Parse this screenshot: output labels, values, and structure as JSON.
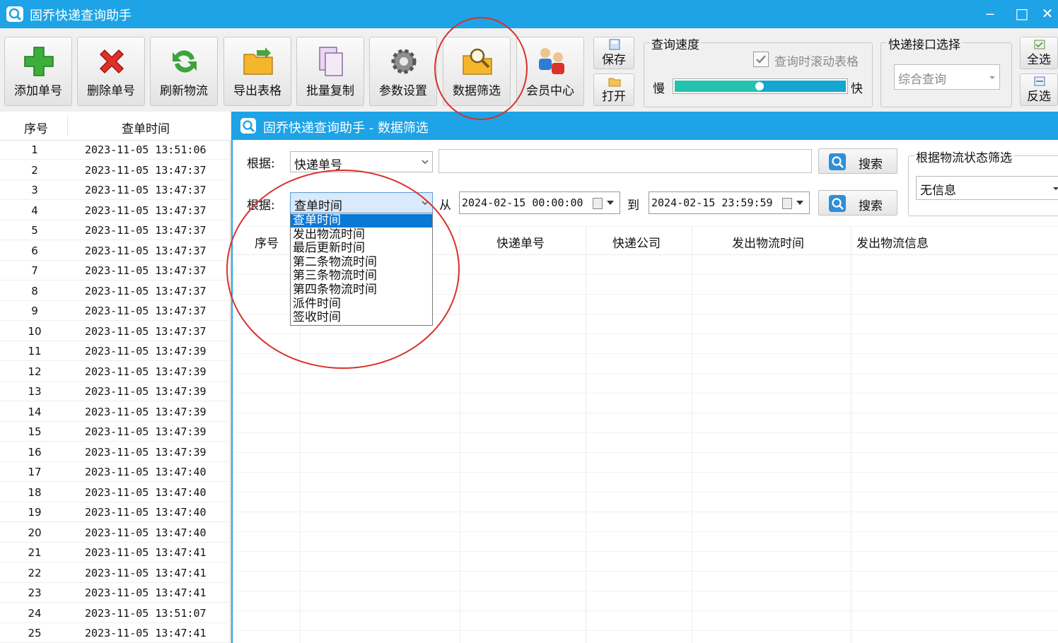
{
  "window": {
    "title": "固乔快递查询助手",
    "minimize": "‒",
    "maximize": "□",
    "close": "✕"
  },
  "toolbar": {
    "buttons": [
      {
        "label": "添加单号",
        "icon": "add-icon"
      },
      {
        "label": "删除单号",
        "icon": "delete-icon"
      },
      {
        "label": "刷新物流",
        "icon": "refresh-icon"
      },
      {
        "label": "导出表格",
        "icon": "export-folder-icon"
      },
      {
        "label": "批量复制",
        "icon": "copy-icon"
      },
      {
        "label": "参数设置",
        "icon": "gear-icon"
      },
      {
        "label": "数据筛选",
        "icon": "magnifier-folder-icon"
      },
      {
        "label": "会员中心",
        "icon": "users-icon"
      }
    ],
    "save_label": "保存",
    "open_label": "打开",
    "speed": {
      "title": "查询速度",
      "scroll_checkbox": "查询时滚动表格",
      "scroll_checked": true,
      "slow": "慢",
      "fast": "快",
      "level": 0.5
    },
    "api": {
      "title": "快递接口选择",
      "selected": "综合查询"
    },
    "select_all": "全选",
    "invert": "反选"
  },
  "left_table": {
    "headers": [
      "序号",
      "查单时间"
    ],
    "rows": [
      [
        "1",
        "2023-11-05 13:51:06"
      ],
      [
        "2",
        "2023-11-05 13:47:37"
      ],
      [
        "3",
        "2023-11-05 13:47:37"
      ],
      [
        "4",
        "2023-11-05 13:47:37"
      ],
      [
        "5",
        "2023-11-05 13:47:37"
      ],
      [
        "6",
        "2023-11-05 13:47:37"
      ],
      [
        "7",
        "2023-11-05 13:47:37"
      ],
      [
        "8",
        "2023-11-05 13:47:37"
      ],
      [
        "9",
        "2023-11-05 13:47:37"
      ],
      [
        "10",
        "2023-11-05 13:47:37"
      ],
      [
        "11",
        "2023-11-05 13:47:39"
      ],
      [
        "12",
        "2023-11-05 13:47:39"
      ],
      [
        "13",
        "2023-11-05 13:47:39"
      ],
      [
        "14",
        "2023-11-05 13:47:39"
      ],
      [
        "15",
        "2023-11-05 13:47:39"
      ],
      [
        "16",
        "2023-11-05 13:47:39"
      ],
      [
        "17",
        "2023-11-05 13:47:40"
      ],
      [
        "18",
        "2023-11-05 13:47:40"
      ],
      [
        "19",
        "2023-11-05 13:47:40"
      ],
      [
        "20",
        "2023-11-05 13:47:40"
      ],
      [
        "21",
        "2023-11-05 13:47:41"
      ],
      [
        "22",
        "2023-11-05 13:47:41"
      ],
      [
        "23",
        "2023-11-05 13:47:41"
      ],
      [
        "24",
        "2023-11-05 13:51:07"
      ],
      [
        "25",
        "2023-11-05 13:47:41"
      ]
    ]
  },
  "filter": {
    "title": "固乔快递查询助手 - 数据筛选",
    "basis_label": "根据:",
    "row1": {
      "field": "快递单号",
      "text_value": "",
      "search": "搜索"
    },
    "row2": {
      "field": "查单时间",
      "from_label": "从",
      "from_value": "2024-02-15 00:00:00",
      "to_label": "到",
      "to_value": "2024-02-15 23:59:59",
      "search": "搜索"
    },
    "status_group": {
      "title": "根据物流状态筛选",
      "selected": "无信息"
    },
    "dropdown_options": [
      "查单时间",
      "发出物流时间",
      "最后更新时间",
      "第二条物流时间",
      "第三条物流时间",
      "第四条物流时间",
      "派件时间",
      "签收时间"
    ],
    "grid_headers": [
      "序号",
      "快递单号",
      "快递公司",
      "发出物流时间",
      "发出物流信息"
    ]
  }
}
